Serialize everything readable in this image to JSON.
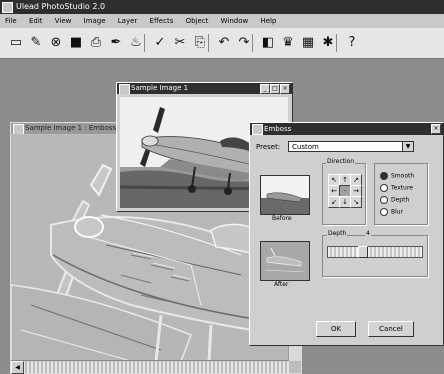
{
  "app": {
    "title": "Ulead PhotoStudio 2.0",
    "menus": [
      "File",
      "Edit",
      "View",
      "Image",
      "Layer",
      "Effects",
      "Object",
      "Window",
      "Help"
    ]
  },
  "windows": {
    "emboss": {
      "title": "Sample Image 1 : Emboss"
    },
    "photo": {
      "title": "Sample Image 1"
    },
    "dialog": {
      "title": "Emboss",
      "preset_label": "Preset:",
      "preset_value": "Custom",
      "direction_label": "Direction",
      "options": [
        "Smooth",
        "Texture",
        "Depth",
        "Blur"
      ],
      "selected_option": 0,
      "before_label": "Before",
      "after_label": "After",
      "depth_label": "Depth",
      "depth_value": "4",
      "depth_level": 0.35,
      "ok_label": "OK",
      "cancel_label": "Cancel"
    }
  },
  "colors": {
    "titlebar": "#2e2e2e",
    "face": "#cfcfcf",
    "workspace": "#8c8c8c"
  },
  "toolbar_icons": [
    {
      "name": "new-icon",
      "glyph": "▭"
    },
    {
      "name": "open-icon",
      "glyph": "✎"
    },
    {
      "name": "scanner-icon",
      "glyph": "⊗"
    },
    {
      "name": "save-icon",
      "glyph": "■"
    },
    {
      "name": "print-icon",
      "glyph": "⎙"
    },
    {
      "name": "paint-icon",
      "glyph": "✒"
    },
    {
      "name": "stamp-icon",
      "glyph": "♨"
    },
    {
      "name": "magic-icon",
      "glyph": "✓"
    },
    {
      "name": "cut-icon",
      "glyph": "✂"
    },
    {
      "name": "paste-icon",
      "glyph": "⎘"
    },
    {
      "name": "undo-icon",
      "glyph": "↶"
    },
    {
      "name": "redo-icon",
      "glyph": "↷"
    },
    {
      "name": "mask-icon",
      "glyph": "◧"
    },
    {
      "name": "effects-icon",
      "glyph": "♛"
    },
    {
      "name": "grid-icon",
      "glyph": "▦"
    },
    {
      "name": "options-icon",
      "glyph": "✱"
    },
    {
      "name": "help-icon",
      "glyph": "?"
    }
  ]
}
